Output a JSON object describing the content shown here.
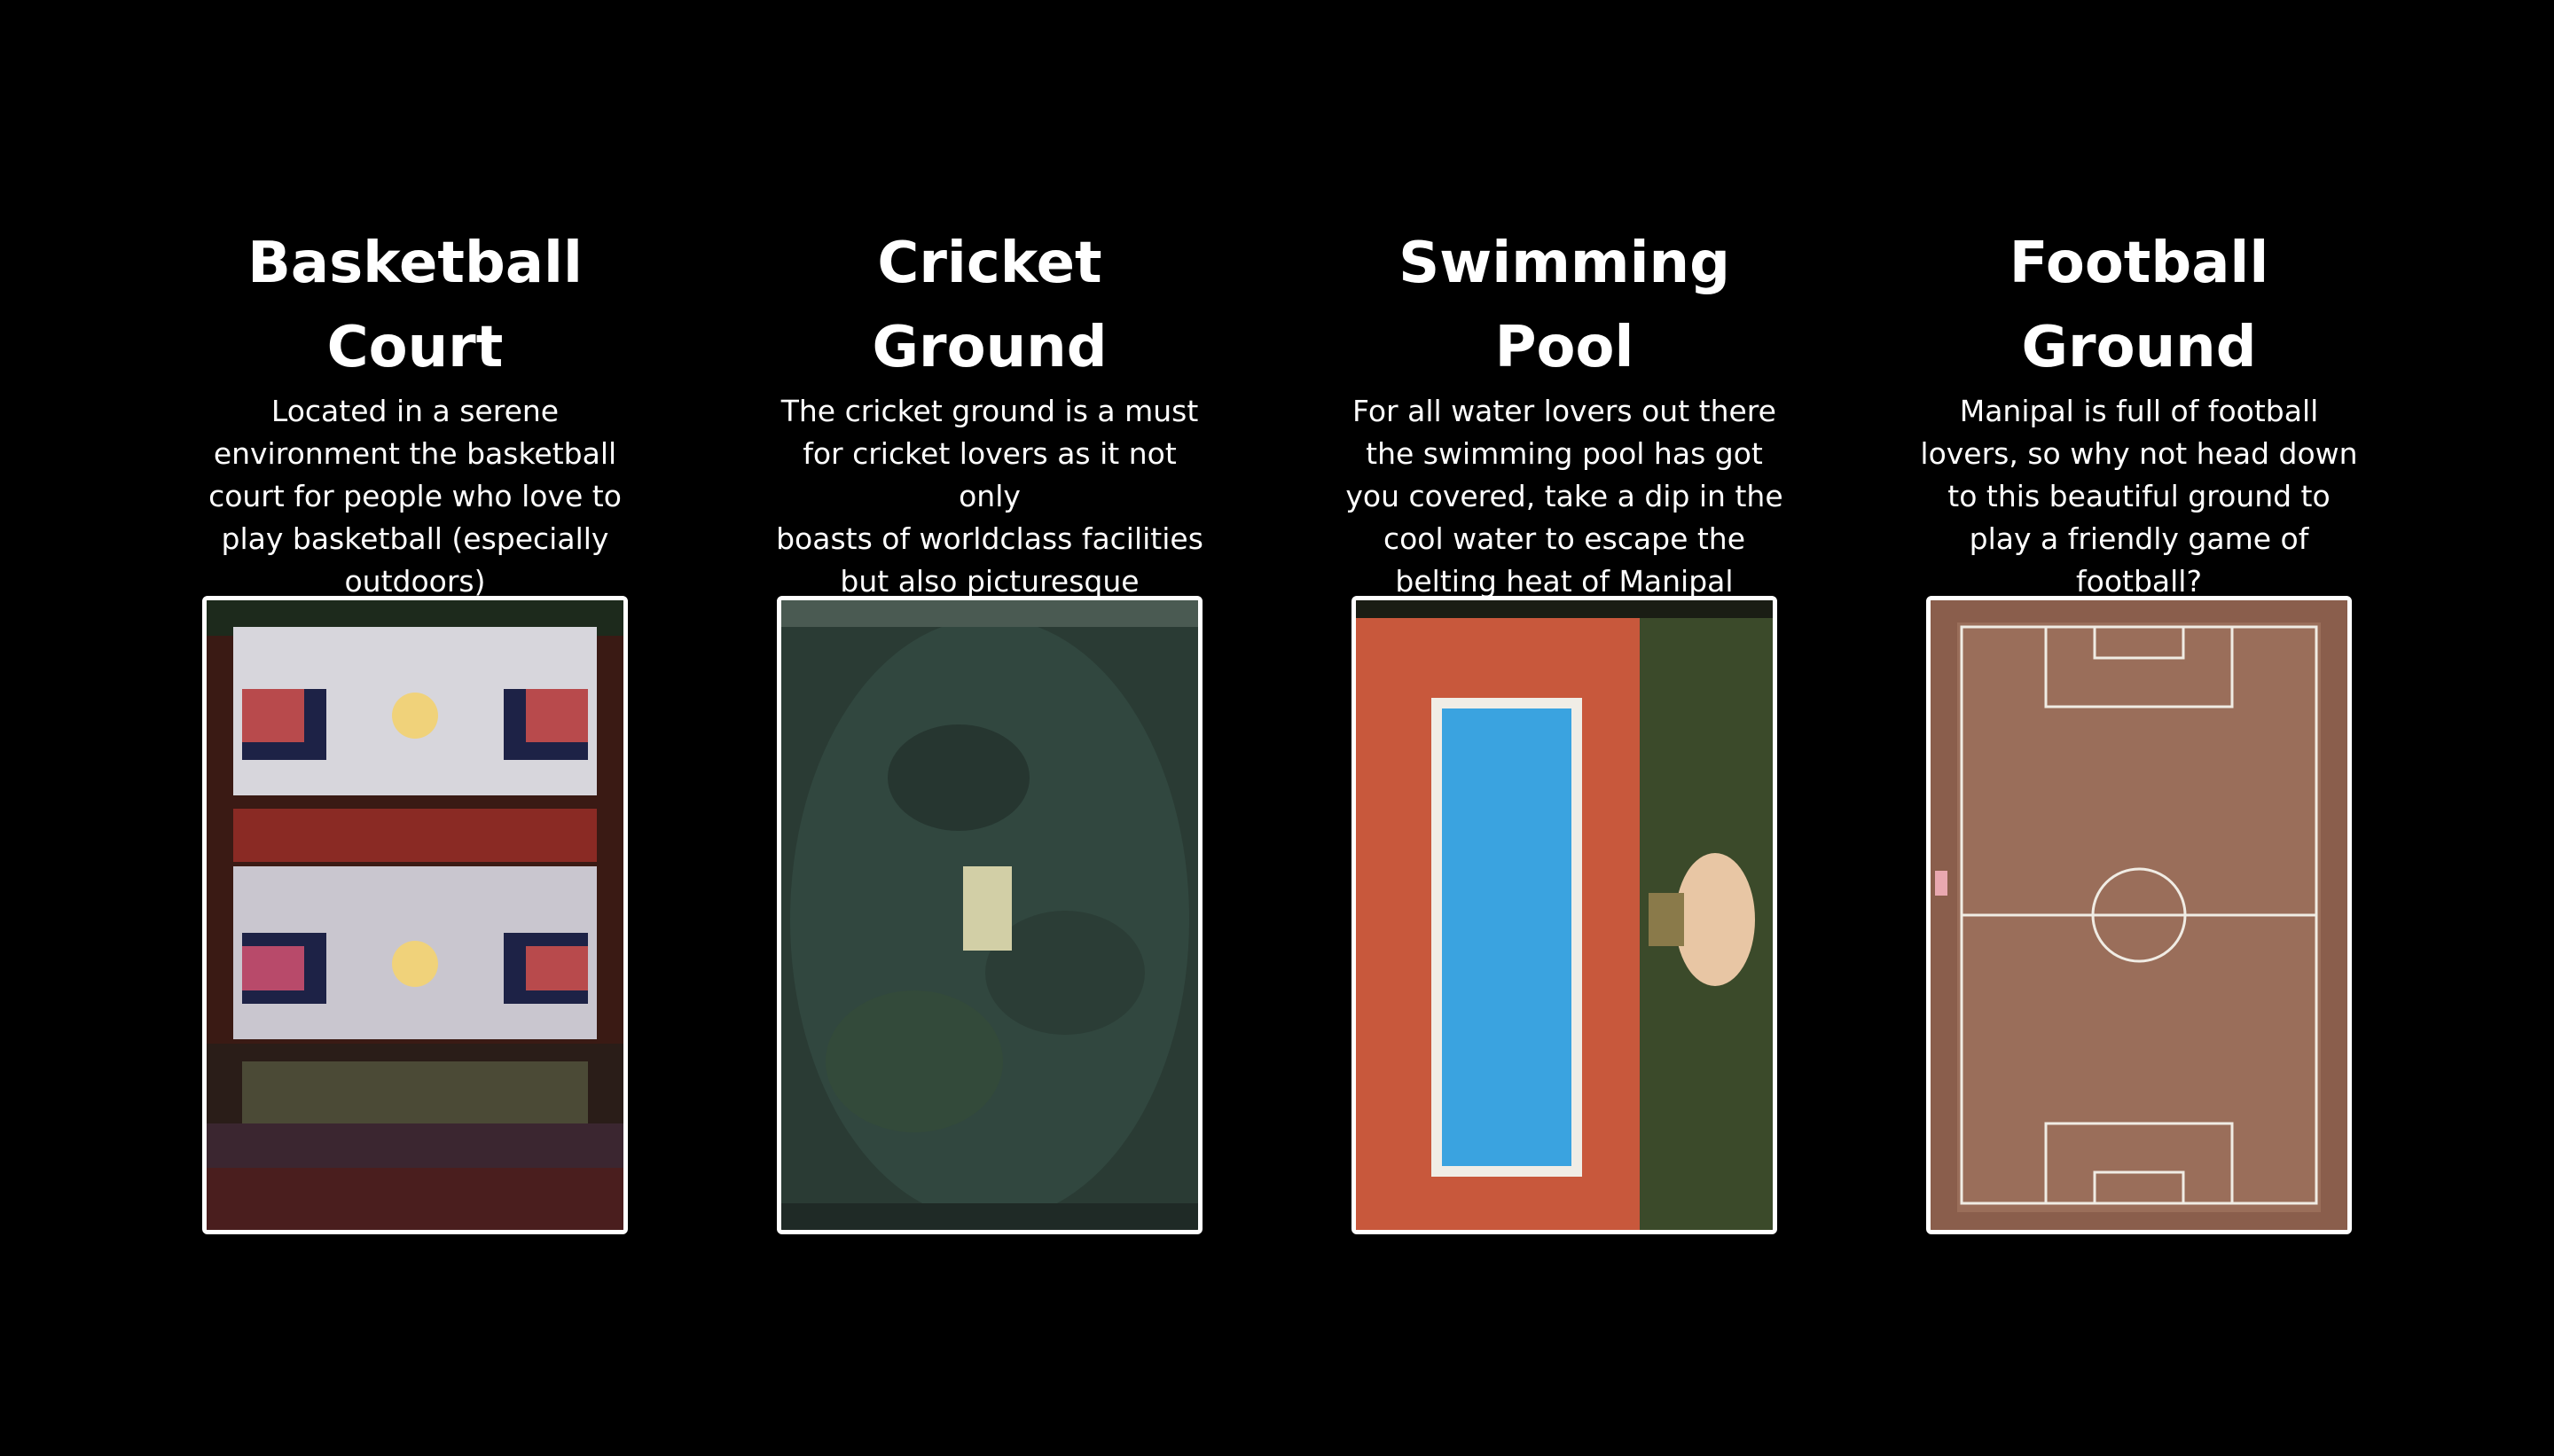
{
  "facilities": [
    {
      "title_line1": "Basketball",
      "title_line2": "Court",
      "description": "Located in a serene\nenvironment the basketball\ncourt for people who love to\nplay basketball (especially\noutdoors)",
      "image": "basketball-court-aerial-photo"
    },
    {
      "title_line1": "Cricket",
      "title_line2": "Ground",
      "description": "The cricket ground is a must\nfor cricket lovers as it not only\nboasts of worldclass facilities\nbut also picturesque\nsurroundings",
      "image": "cricket-ground-aerial-photo"
    },
    {
      "title_line1": "Swimming",
      "title_line2": "Pool",
      "description": "For all water lovers out there\nthe swimming pool has got\nyou covered, take a dip in the\ncool water to escape the\nbelting heat of Manipal",
      "image": "swimming-pool-aerial-photo"
    },
    {
      "title_line1": "Football",
      "title_line2": "Ground",
      "description": "Manipal is full of football\nlovers, so why not head down\nto this beautiful ground to\nplay a friendly game of\nfootball?",
      "image": "football-ground-aerial-photo"
    }
  ],
  "colors": {
    "background": "#000000",
    "text": "#ffffff",
    "frame": "#ffffff"
  }
}
